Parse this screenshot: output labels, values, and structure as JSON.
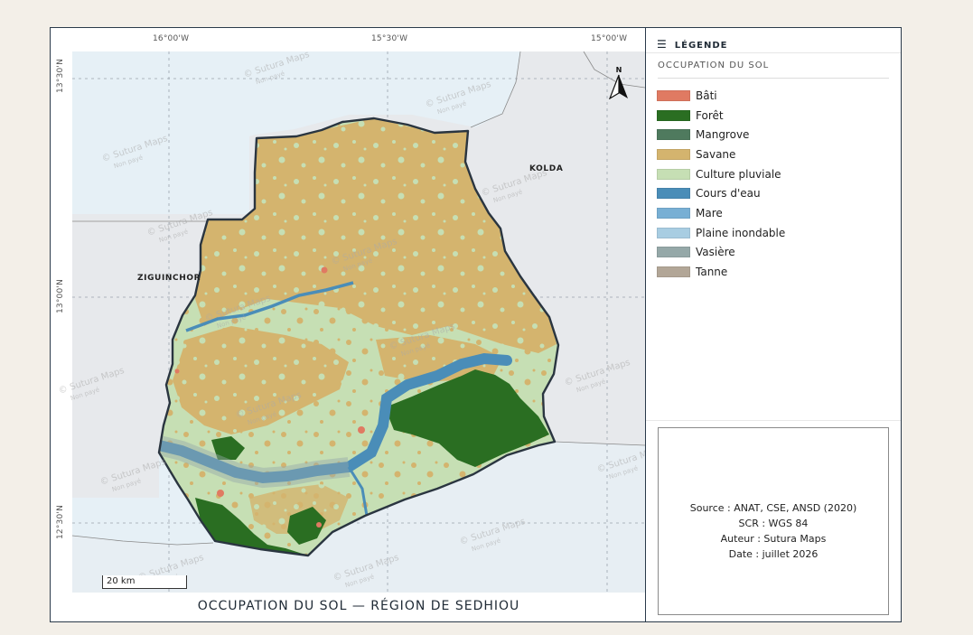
{
  "map": {
    "title": "OCCUPATION DU SOL — RÉGION DE SEDHIOU",
    "coords_top": [
      "16°00'W",
      "15°30'W",
      "15°00'W"
    ],
    "coords_left": [
      "13°30'N",
      "13°00'N",
      "12°30'N"
    ],
    "places": [
      "ZIGUINCHOR",
      "KOLDA"
    ],
    "north": "N",
    "scale": "20 km",
    "watermark_line1": "© Sutura Maps",
    "watermark_line2": "Non payé"
  },
  "legend": {
    "header": "LÉGENDE",
    "section": "OCCUPATION DU SOL",
    "items": [
      {
        "label": "Bâti",
        "color": "#e07a62"
      },
      {
        "label": "Forêt",
        "color": "#2a6e22"
      },
      {
        "label": "Mangrove",
        "color": "#4f7a5e"
      },
      {
        "label": "Savane",
        "color": "#d4b46e"
      },
      {
        "label": "Culture pluviale",
        "color": "#c6dfb4"
      },
      {
        "label": "Cours d'eau",
        "color": "#4a8db8"
      },
      {
        "label": "Mare",
        "color": "#78afd4"
      },
      {
        "label": "Plaine inondable",
        "color": "#a8cde2"
      },
      {
        "label": "Vasière",
        "color": "#95a8a8"
      },
      {
        "label": "Tanne",
        "color": "#b2a697"
      }
    ]
  },
  "source": {
    "line1": "Source : ANAT, CSE, ANSD (2020)",
    "line2": "SCR : WGS 84",
    "line3": "Auteur : Sutura Maps",
    "line4": "Date : juillet 2026"
  }
}
